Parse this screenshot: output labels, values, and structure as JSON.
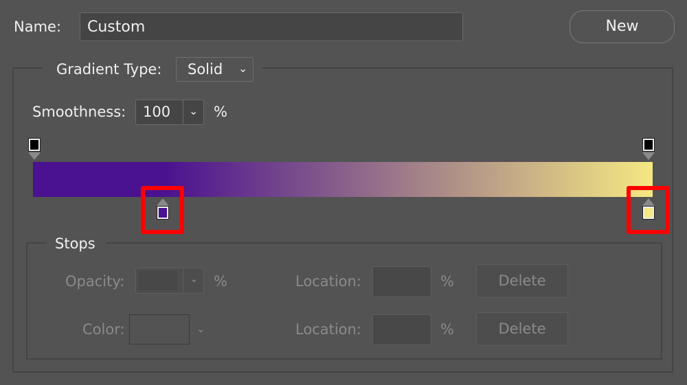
{
  "name": {
    "label": "Name:",
    "value": "Custom"
  },
  "new_button": "New",
  "gradient_type": {
    "label": "Gradient Type:",
    "value": "Solid"
  },
  "smoothness": {
    "label": "Smoothness:",
    "value": "100",
    "unit": "%"
  },
  "gradient": {
    "start_color": "#4a1190",
    "end_color": "#f5e882",
    "opacity_stops": [
      {
        "location_pct": 0,
        "color": "#000000"
      },
      {
        "location_pct": 100,
        "color": "#000000"
      }
    ],
    "color_stops": [
      {
        "location_pct": 21,
        "color": "#4a1190",
        "highlighted": true
      },
      {
        "location_pct": 100,
        "color": "#f5e882",
        "highlighted": true
      }
    ]
  },
  "stops": {
    "title": "Stops",
    "opacity_label": "Opacity:",
    "opacity_unit": "%",
    "location_label": "Location:",
    "location_unit": "%",
    "color_label": "Color:",
    "delete_label": "Delete"
  },
  "colors": {
    "highlight": "#ff0000",
    "background": "#535353"
  }
}
